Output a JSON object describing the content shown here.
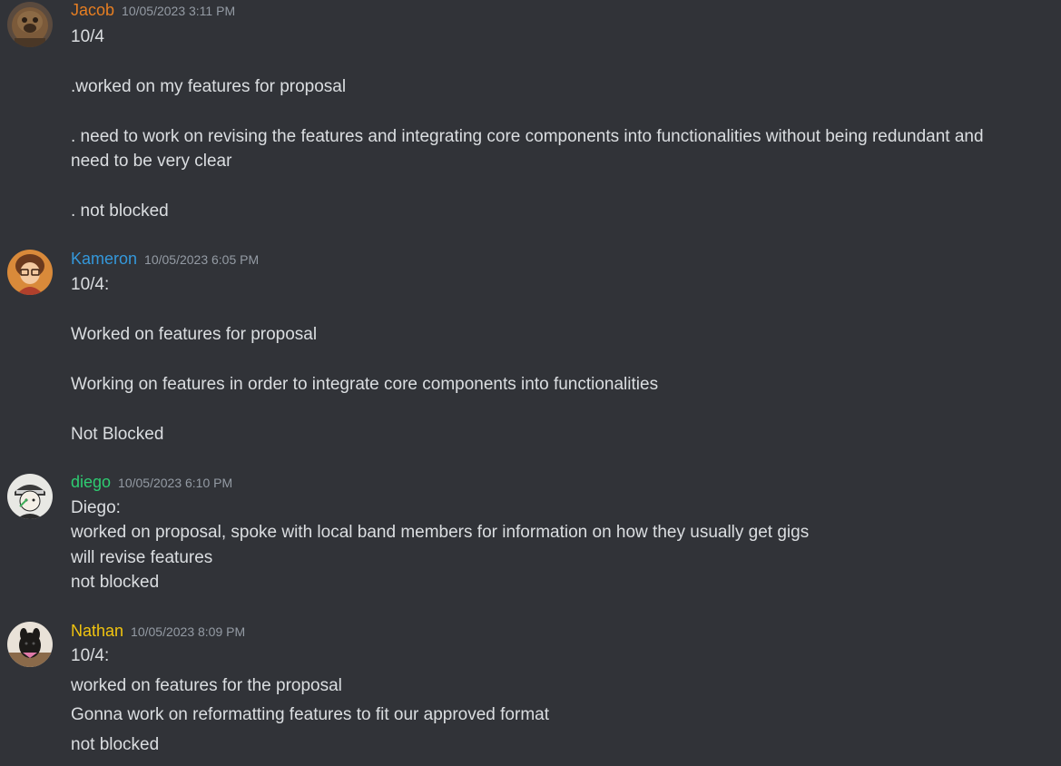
{
  "colors": {
    "background": "#313338",
    "text": "#dbdee1",
    "timestamp": "#949ba4"
  },
  "messages": [
    {
      "username": "Jacob",
      "username_color": "#e67e22",
      "timestamp": "10/05/2023 3:11 PM",
      "avatar_icon": "avatar-jacob-icon",
      "lines": [
        "10/4",
        ".worked on my features for proposal",
        ". need to work on revising the features and integrating core components into functionalities without being redundant and need to be very clear",
        ". not blocked"
      ]
    },
    {
      "username": "Kameron",
      "username_color": "#3498db",
      "timestamp": "10/05/2023 6:05 PM",
      "avatar_icon": "avatar-kameron-icon",
      "lines": [
        "10/4:",
        "Worked on features for proposal",
        "Working on features in order to integrate core components into functionalities",
        "Not Blocked"
      ]
    },
    {
      "username": "diego",
      "username_color": "#2ecc71",
      "timestamp": "10/05/2023 6:10 PM",
      "avatar_icon": "avatar-diego-icon",
      "lines": [
        "Diego:",
        "worked on proposal, spoke with local band members for information on how they usually get gigs",
        "will revise features",
        "not blocked"
      ]
    },
    {
      "username": "Nathan",
      "username_color": "#f1c40f",
      "timestamp": "10/05/2023 8:09 PM",
      "avatar_icon": "avatar-nathan-icon",
      "lines": [
        "10/4:",
        "worked on features for the proposal",
        "Gonna work on reformatting features to fit our approved format",
        "not blocked"
      ]
    }
  ]
}
